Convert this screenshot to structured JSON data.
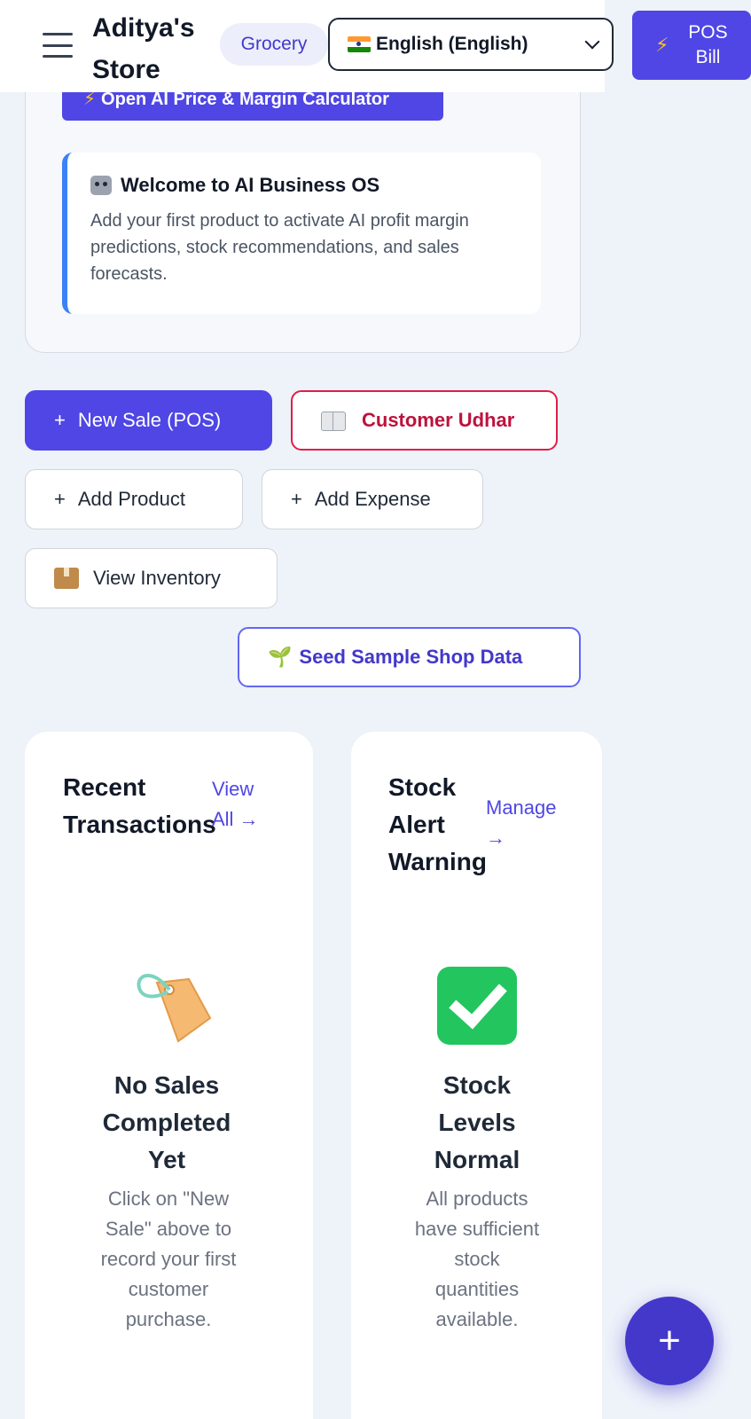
{
  "header": {
    "store_name": "Aditya's Store",
    "category": "Grocery",
    "language": "English (English)",
    "pos_button": "POS Bill"
  },
  "ai_card": {
    "calculator_button": "Open AI Price & Margin Calculator",
    "welcome_title": "Welcome to AI Business OS",
    "welcome_text": "Add your first product to activate AI profit margin predictions, stock recommendations, and sales forecasts."
  },
  "actions": {
    "new_sale": "New Sale (POS)",
    "customer_udhar": "Customer Udhar",
    "add_product": "Add Product",
    "add_expense": "Add Expense",
    "view_inventory": "View Inventory",
    "seed_data": "Seed Sample Shop Data"
  },
  "recent_transactions": {
    "title": "Recent Transactions",
    "link": "View All →",
    "empty_title": "No Sales Completed Yet",
    "empty_text": "Click on \"New Sale\" above to record your first customer purchase."
  },
  "stock_alert": {
    "title": "Stock Alert Warning",
    "link": "Manage →",
    "empty_title": "Stock Levels Normal",
    "empty_text": "All products have sufficient stock quantities available."
  },
  "fab": {
    "label": "+"
  },
  "colors": {
    "primary": "#4f46e5",
    "udhar": "#e11d48",
    "background": "#eef2f9",
    "accent_border": "#3b82f6"
  }
}
